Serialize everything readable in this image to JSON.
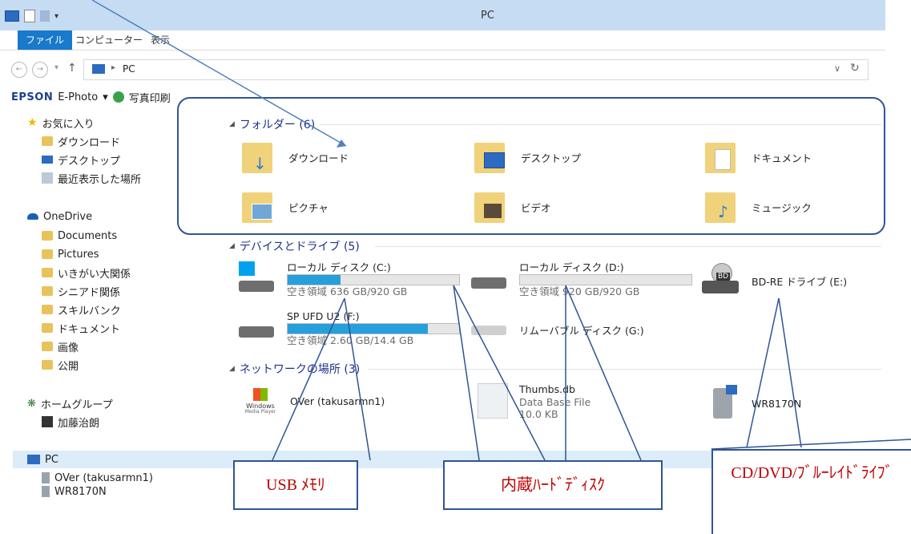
{
  "window": {
    "title": "PC"
  },
  "ribbon": {
    "tabs": [
      "ファイル",
      "コンピューター",
      "表示"
    ]
  },
  "address": {
    "path_icon": "pc-icon",
    "separator": "▸",
    "location": "PC"
  },
  "epson_toolbar": {
    "brand": "EPSON",
    "app": "E-Photo",
    "dropdown": "▾",
    "print_label": "写真印刷"
  },
  "nav": {
    "favorites": {
      "label": "お気に入り",
      "items": [
        "ダウンロード",
        "デスクトップ",
        "最近表示した場所"
      ]
    },
    "onedrive": {
      "label": "OneDrive",
      "items": [
        "Documents",
        "Pictures",
        "いきがい大関係",
        "シニアド関係",
        "スキルバンク",
        "ドキュメント",
        "画像",
        "公開"
      ]
    },
    "homegroup": {
      "label": "ホームグループ",
      "items": [
        "加藤治朗"
      ]
    },
    "pc": {
      "label": "PC",
      "items": [
        "OVer (takusarmn1)",
        "WR8170N"
      ]
    }
  },
  "folders": {
    "header": "フォルダー (6)",
    "items": [
      {
        "label": "ダウンロード",
        "icon": "download-folder-icon"
      },
      {
        "label": "デスクトップ",
        "icon": "desktop-folder-icon"
      },
      {
        "label": "ドキュメント",
        "icon": "documents-folder-icon"
      },
      {
        "label": "ピクチャ",
        "icon": "pictures-folder-icon"
      },
      {
        "label": "ビデオ",
        "icon": "videos-folder-icon"
      },
      {
        "label": "ミュージック",
        "icon": "music-folder-icon"
      }
    ]
  },
  "devices": {
    "header": "デバイスとドライブ (5)",
    "items": [
      {
        "name": "ローカル ディスク (C:)",
        "free": "空き領域 636 GB/920 GB",
        "used_fraction": 0.31
      },
      {
        "name": "ローカル ディスク (D:)",
        "free": "空き領域 920 GB/920 GB",
        "used_fraction": 0.0
      },
      {
        "name": "BD-RE ドライブ (E:)",
        "badge": "BD"
      },
      {
        "name": "SP UFD U2 (F:)",
        "free": "空き領域 2.60 GB/14.4 GB",
        "used_fraction": 0.82
      },
      {
        "name": "リムーバブル ディスク (G:)"
      }
    ]
  },
  "network": {
    "header": "ネットワークの場所 (3)",
    "items": [
      {
        "name": "OVer (takusarmn1)",
        "logo_line1": "Windows",
        "logo_line2": "Media Player"
      },
      {
        "name": "Thumbs.db",
        "type": "Data Base File",
        "size": "10.0 KB"
      },
      {
        "name": "WR8170N"
      }
    ]
  },
  "annotations": {
    "usb": "USB ﾒﾓﾘ",
    "hdd": "内蔵ﾊｰﾄﾞﾃﾞｨｽｸ",
    "optical": "CD/DVD/ﾌﾞﾙｰﾚｲﾄﾞﾗｲﾌﾞ"
  },
  "colors": {
    "accent": "#1979ca",
    "bar_fill": "#26a0da",
    "header_text": "#1e3287",
    "annotation_line": "#2f5496",
    "annotation_text": "#c00000"
  }
}
